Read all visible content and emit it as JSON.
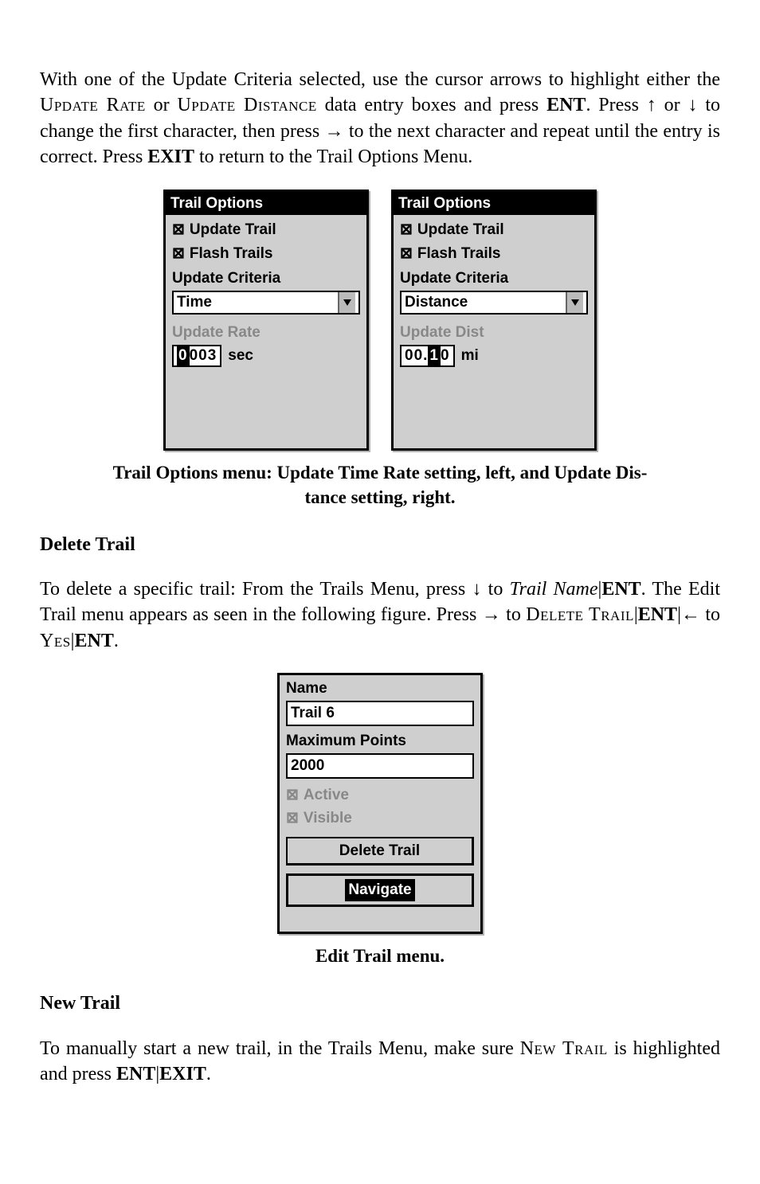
{
  "para1": {
    "s1": "With one of the Update Criteria selected, use the cursor arrows to highlight either the ",
    "rate": "Update Rate",
    "or": " or ",
    "dist": "Update Distance",
    "s2": " data entry boxes and press ",
    "ent1": "ENT",
    "s3": ". Press ↑ or ↓ to change the first character, then press → to the next character and repeat until the entry is correct. Press ",
    "exit": "EXIT",
    "s4": " to return to the Trail Options Menu."
  },
  "fig1": {
    "left": {
      "title": "Trail Options",
      "updateTrail": "Update Trail",
      "flashTrails": "Flash Trails",
      "updateCriteria": "Update Criteria",
      "criteriaValue": "Time",
      "rateLabel": "Update Rate",
      "valueChar": "0",
      "valueRest": "003",
      "unit": "sec"
    },
    "right": {
      "title": "Trail Options",
      "updateTrail": "Update Trail",
      "flashTrails": "Flash Trails",
      "updateCriteria": "Update Criteria",
      "criteriaValue": "Distance",
      "rateLabel": "Update Dist",
      "valuePre": "00.",
      "valueChar": "1",
      "valuePost": "0",
      "unit": "mi"
    }
  },
  "caption1a": "Trail Options menu: Update Time Rate setting, left, and Update Dis-",
  "caption1b": "tance setting, right.",
  "deleteTrail": {
    "heading": "Delete Trail",
    "p1a": "To delete a specific trail: From the Trails Menu, press ↓ to ",
    "name": "Trail Name",
    "bar1": "|",
    "ent": "ENT",
    "p1b": ". The Edit Trail menu appears as seen in the following figure. Press → to ",
    "del": "Delete Trail",
    "bar2": "|",
    "ent2": "ENT",
    "bar3": "|",
    "arr": "← to ",
    "yes": "Yes",
    "bar4": "|",
    "ent3": "ENT",
    "dot": "."
  },
  "fig2": {
    "nameLabel": "Name",
    "nameValue": "Trail 6",
    "maxLabel": "Maximum Points",
    "maxValue": "2000",
    "active": "Active",
    "visible": "Visible",
    "deleteBtn": "Delete Trail",
    "navBtn": "Navigate"
  },
  "caption2": "Edit Trail menu.",
  "newTrail": {
    "heading": "New Trail",
    "p1a": "To manually start a new trail, in the Trails Menu, make sure ",
    "nt": "New Trail",
    "p1b": " is highlighted and press ",
    "ent": "ENT",
    "bar": "|",
    "exit": "EXIT",
    "dot": "."
  }
}
